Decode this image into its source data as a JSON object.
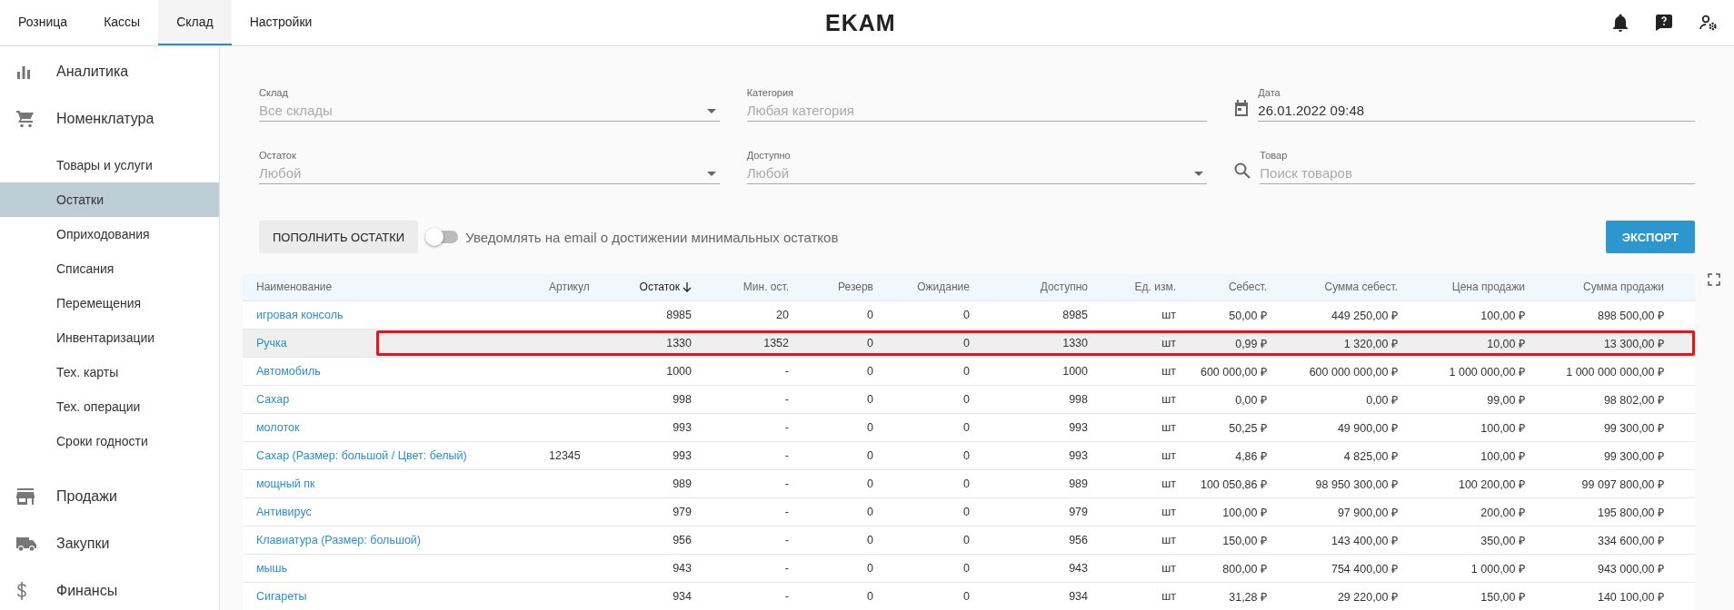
{
  "top_tabs": [
    {
      "label": "Розница",
      "selected": false
    },
    {
      "label": "Кассы",
      "selected": false
    },
    {
      "label": "Склад",
      "selected": true
    },
    {
      "label": "Настройки",
      "selected": false
    }
  ],
  "logo": "EKAM",
  "sidebar": {
    "items": [
      {
        "label": "Аналитика",
        "kind": "chart"
      },
      {
        "label": "Номенклатура",
        "kind": "cart",
        "children": [
          {
            "label": "Товары и услуги",
            "selected": false
          },
          {
            "label": "Остатки",
            "selected": true
          },
          {
            "label": "Оприходования",
            "selected": false
          },
          {
            "label": "Списания",
            "selected": false
          },
          {
            "label": "Перемещения",
            "selected": false
          },
          {
            "label": "Инвентаризации",
            "selected": false
          },
          {
            "label": "Тех. карты",
            "selected": false
          },
          {
            "label": "Тех. операции",
            "selected": false
          },
          {
            "label": "Сроки годности",
            "selected": false
          }
        ]
      },
      {
        "label": "Продажи",
        "kind": "store"
      },
      {
        "label": "Закупки",
        "kind": "truck"
      },
      {
        "label": "Финансы",
        "kind": "dollar"
      }
    ]
  },
  "filters": [
    {
      "kind": "select",
      "label": "Склад",
      "placeholder": "Все склады"
    },
    {
      "kind": "text",
      "label": "Категория",
      "placeholder": "Любая категория"
    },
    {
      "kind": "date",
      "label": "Дата",
      "value": "26.01.2022 09:48"
    },
    {
      "kind": "select",
      "label": "Остаток",
      "placeholder": "Любой"
    },
    {
      "kind": "select",
      "label": "Доступно",
      "placeholder": "Любой"
    },
    {
      "kind": "search",
      "label": "Товар",
      "placeholder": "Поиск товаров"
    }
  ],
  "refill_button": "ПОПОЛНИТЬ ОСТАТКИ",
  "notify_toggle": {
    "label": "Уведомлять на email о достижении минимальных остатков",
    "on": false
  },
  "export_button": "ЭКСПОРТ",
  "table": {
    "columns": [
      {
        "label": "Наименование",
        "sorted": false
      },
      {
        "label": "Артикул",
        "sorted": false
      },
      {
        "label": "Остаток",
        "sorted": true
      },
      {
        "label": "Мин. ост.",
        "sorted": false
      },
      {
        "label": "Резерв",
        "sorted": false
      },
      {
        "label": "Ожидание",
        "sorted": false
      },
      {
        "label": "Доступно",
        "sorted": false
      },
      {
        "label": "Ед. изм.",
        "sorted": false
      },
      {
        "label": "Себест.",
        "sorted": false
      },
      {
        "label": "Сумма себест.",
        "sorted": false
      },
      {
        "label": "Цена продажи",
        "sorted": false
      },
      {
        "label": "Сумма продажи",
        "sorted": false
      }
    ],
    "rows": [
      {
        "highlighted": false,
        "cells": [
          "игровая консоль",
          "",
          "8985",
          "20",
          "0",
          "0",
          "8985",
          "шт",
          "50,00 ₽",
          "449 250,00 ₽",
          "100,00 ₽",
          "898 500,00 ₽"
        ]
      },
      {
        "highlighted": true,
        "cells": [
          "Ручка",
          "",
          "1330",
          "1352",
          "0",
          "0",
          "1330",
          "шт",
          "0,99 ₽",
          "1 320,00 ₽",
          "10,00 ₽",
          "13 300,00 ₽"
        ]
      },
      {
        "highlighted": false,
        "cells": [
          "Автомобиль",
          "",
          "1000",
          "-",
          "0",
          "0",
          "1000",
          "шт",
          "600 000,00 ₽",
          "600 000 000,00 ₽",
          "1 000 000,00 ₽",
          "1 000 000 000,00 ₽"
        ]
      },
      {
        "highlighted": false,
        "cells": [
          "Сахар",
          "",
          "998",
          "-",
          "0",
          "0",
          "998",
          "шт",
          "0,00 ₽",
          "0,00 ₽",
          "99,00 ₽",
          "98 802,00 ₽"
        ]
      },
      {
        "highlighted": false,
        "cells": [
          "молоток",
          "",
          "993",
          "-",
          "0",
          "0",
          "993",
          "шт",
          "50,25 ₽",
          "49 900,00 ₽",
          "100,00 ₽",
          "99 300,00 ₽"
        ]
      },
      {
        "highlighted": false,
        "cells": [
          "Сахар (Размер: большой / Цвет: белый)",
          "12345",
          "993",
          "-",
          "0",
          "0",
          "993",
          "шт",
          "4,86 ₽",
          "4 825,00 ₽",
          "100,00 ₽",
          "99 300,00 ₽"
        ]
      },
      {
        "highlighted": false,
        "cells": [
          "мощный пк",
          "",
          "989",
          "-",
          "0",
          "0",
          "989",
          "шт",
          "100 050,86 ₽",
          "98 950 300,00 ₽",
          "100 200,00 ₽",
          "99 097 800,00 ₽"
        ]
      },
      {
        "highlighted": false,
        "cells": [
          "Антивирус",
          "",
          "979",
          "-",
          "0",
          "0",
          "979",
          "шт",
          "100,00 ₽",
          "97 900,00 ₽",
          "200,00 ₽",
          "195 800,00 ₽"
        ]
      },
      {
        "highlighted": false,
        "cells": [
          "Клавиатура (Размер: большой)",
          "",
          "956",
          "-",
          "0",
          "0",
          "956",
          "шт",
          "150,00 ₽",
          "143 400,00 ₽",
          "350,00 ₽",
          "334 600,00 ₽"
        ]
      },
      {
        "highlighted": false,
        "cells": [
          "мышь",
          "",
          "943",
          "-",
          "0",
          "0",
          "943",
          "шт",
          "800,00 ₽",
          "754 400,00 ₽",
          "1 000,00 ₽",
          "943 000,00 ₽"
        ]
      },
      {
        "highlighted": false,
        "cells": [
          "Сигареты",
          "",
          "934",
          "-",
          "0",
          "0",
          "934",
          "шт",
          "31,28 ₽",
          "29 220,00 ₽",
          "150,00 ₽",
          "140 100,00 ₽"
        ]
      }
    ]
  }
}
